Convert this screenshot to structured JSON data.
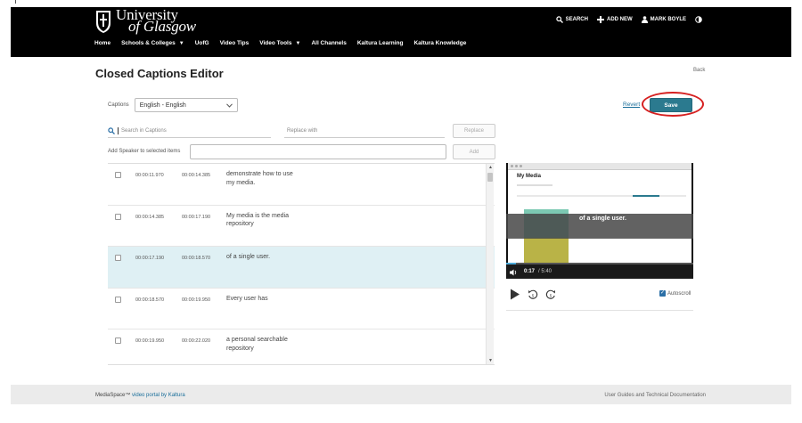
{
  "header": {
    "logo_line1": "University",
    "logo_line2": "of Glasgow",
    "actions": {
      "search": "SEARCH",
      "add_new": "ADD NEW",
      "user": "MARK BOYLE"
    },
    "nav": [
      "Home",
      "Schools & Colleges",
      "UofG",
      "Video Tips",
      "Video Tools",
      "All Channels",
      "Kaltura Learning",
      "Kaltura Knowledge"
    ]
  },
  "page": {
    "title": "Closed Captions Editor",
    "back": "Back"
  },
  "captions": {
    "label": "Captions",
    "selected": "English - English"
  },
  "actions": {
    "revert": "Revert",
    "save": "Save"
  },
  "search": {
    "placeholder": "Search in Captions",
    "replace_placeholder": "Replace with",
    "replace_button": "Replace"
  },
  "speaker": {
    "label": "Add Speaker to selected items",
    "add_button": "Add"
  },
  "rows": [
    {
      "start": "00:00:11.970",
      "end": "00:00:14.385",
      "text": "demonstrate how to use my media."
    },
    {
      "start": "00:00:14.385",
      "end": "00:00:17.190",
      "text": "My media is the media repository"
    },
    {
      "start": "00:00:17.190",
      "end": "00:00:18.570",
      "text": "of a single user."
    },
    {
      "start": "00:00:18.570",
      "end": "00:00:19.950",
      "text": "Every user has"
    },
    {
      "start": "00:00:19.950",
      "end": "00:00:22.020",
      "text": "a personal searchable repository"
    }
  ],
  "player": {
    "overlay_caption": "of a single user.",
    "current_time": "0:17",
    "total_time": "/ 5:40",
    "thumb_title": "My Media",
    "progress": 0.05
  },
  "autoscroll": {
    "label": "Autoscroll",
    "checked": true
  },
  "footer": {
    "left_prefix": "MediaSpace™ ",
    "left_link": "video portal by Kaltura",
    "right": "User Guides and Technical Documentation"
  },
  "colors": {
    "header_bg": "#000000",
    "save_bg": "#2b7a8f",
    "active_row": "#dff0f4",
    "highlight_ring": "#d62020"
  }
}
